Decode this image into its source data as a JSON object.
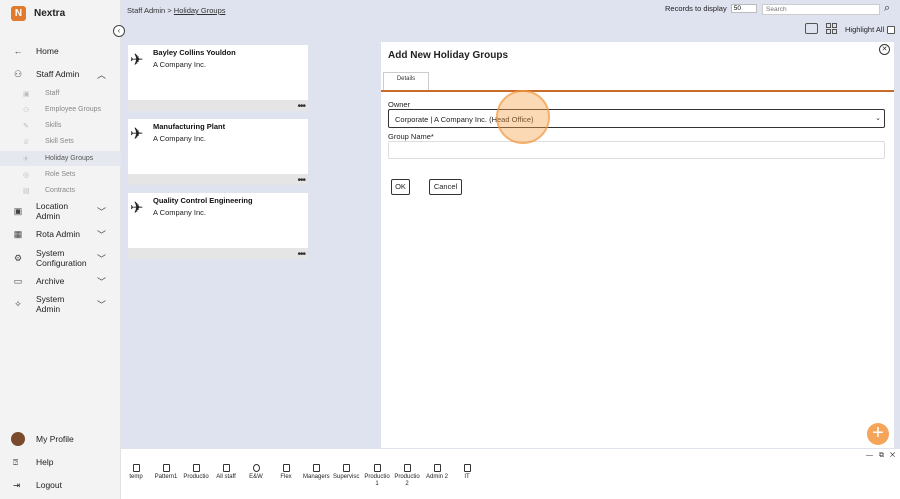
{
  "app": {
    "name": "Nextra",
    "logo_letter": "N",
    "accent": "#e07a2e"
  },
  "sidebar": {
    "home": "Home",
    "staff_admin": "Staff Admin",
    "sub_items": [
      "Staff",
      "Employee Groups",
      "Skills",
      "Skill Sets",
      "Holiday Groups",
      "Role Sets",
      "Contracts"
    ],
    "location_admin": "Location Admin",
    "rota_admin": "Rota Admin",
    "system_configuration": "System Configuration",
    "archive": "Archive",
    "system_admin": "System Admin",
    "my_profile": "My Profile",
    "help": "Help",
    "logout": "Logout"
  },
  "breadcrumb": {
    "parent": "Staff Admin",
    "separator": ">",
    "current": "Holiday Groups"
  },
  "toolbar": {
    "records_label": "Records to display",
    "records_value": "50",
    "search_placeholder": "Search",
    "highlight_all": "Highlight All"
  },
  "cards": [
    {
      "title": "Bayley Collins Youldon",
      "company": "A Company Inc."
    },
    {
      "title": "Manufacturing Plant",
      "company": "A Company Inc."
    },
    {
      "title": "Quality Control Engineering",
      "company": "A Company Inc."
    }
  ],
  "dialog": {
    "title": "Add New Holiday Groups",
    "tab": "Details",
    "owner_label": "Owner",
    "owner_value": "Corporate | A Company Inc. (Head Office)",
    "group_name_label": "Group Name*",
    "ok": "OK",
    "cancel": "Cancel"
  },
  "bottom_bar": [
    "temp",
    "Pattern1",
    "Productio",
    "All staff",
    "E&W",
    "Flex",
    "Managers",
    "Supervisc",
    "Productio 1",
    "Productio 2",
    "Admin 2",
    "IT"
  ]
}
